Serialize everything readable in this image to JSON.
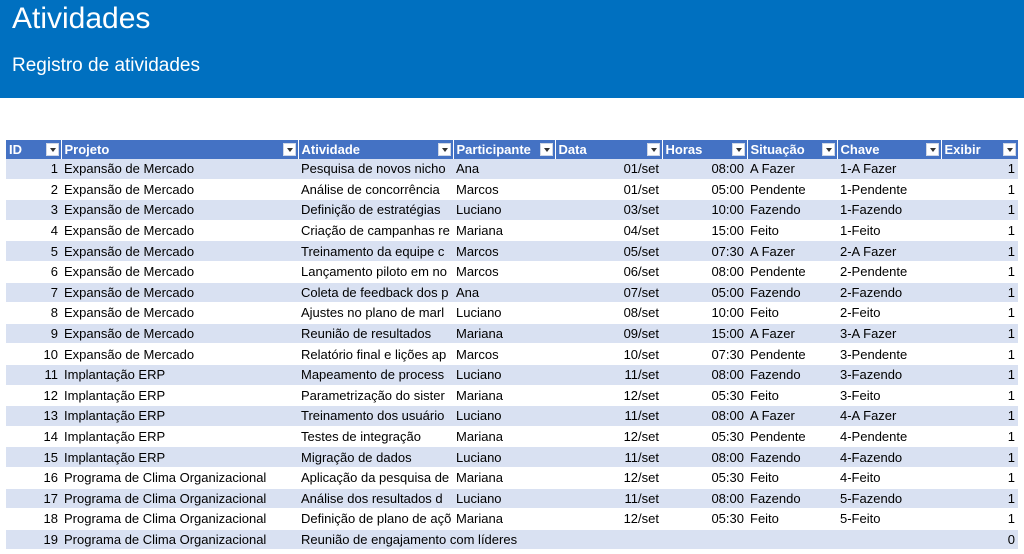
{
  "header": {
    "title": "Atividades",
    "subtitle": "Registro de atividades"
  },
  "colors": {
    "banner": "#0070c0",
    "table_header": "#4472c4",
    "band": "#d9e1f2"
  },
  "table": {
    "columns": [
      "ID",
      "Projeto",
      "Atividade",
      "Participante",
      "Data",
      "Horas",
      "Situação",
      "Chave",
      "Exibir"
    ],
    "rows": [
      {
        "id": "1",
        "projeto": "Expansão de Mercado",
        "atividade": "Pesquisa de novos nicho",
        "participante": "Ana",
        "data": "01/set",
        "horas": "08:00",
        "situacao": "A Fazer",
        "chave": "1-A Fazer",
        "exibir": "1"
      },
      {
        "id": "2",
        "projeto": "Expansão de Mercado",
        "atividade": "Análise de concorrência",
        "participante": "Marcos",
        "data": "01/set",
        "horas": "05:00",
        "situacao": "Pendente",
        "chave": "1-Pendente",
        "exibir": "1"
      },
      {
        "id": "3",
        "projeto": "Expansão de Mercado",
        "atividade": "Definição de estratégias",
        "participante": "Luciano",
        "data": "03/set",
        "horas": "10:00",
        "situacao": "Fazendo",
        "chave": "1-Fazendo",
        "exibir": "1"
      },
      {
        "id": "4",
        "projeto": "Expansão de Mercado",
        "atividade": "Criação de campanhas re",
        "participante": "Mariana",
        "data": "04/set",
        "horas": "15:00",
        "situacao": "Feito",
        "chave": "1-Feito",
        "exibir": "1"
      },
      {
        "id": "5",
        "projeto": "Expansão de Mercado",
        "atividade": "Treinamento da equipe c",
        "participante": "Marcos",
        "data": "05/set",
        "horas": "07:30",
        "situacao": "A Fazer",
        "chave": "2-A Fazer",
        "exibir": "1"
      },
      {
        "id": "6",
        "projeto": "Expansão de Mercado",
        "atividade": "Lançamento piloto em no",
        "participante": "Marcos",
        "data": "06/set",
        "horas": "08:00",
        "situacao": "Pendente",
        "chave": "2-Pendente",
        "exibir": "1"
      },
      {
        "id": "7",
        "projeto": "Expansão de Mercado",
        "atividade": "Coleta de feedback dos p",
        "participante": "Ana",
        "data": "07/set",
        "horas": "05:00",
        "situacao": "Fazendo",
        "chave": "2-Fazendo",
        "exibir": "1"
      },
      {
        "id": "8",
        "projeto": "Expansão de Mercado",
        "atividade": "Ajustes no plano de marl",
        "participante": "Luciano",
        "data": "08/set",
        "horas": "10:00",
        "situacao": "Feito",
        "chave": "2-Feito",
        "exibir": "1"
      },
      {
        "id": "9",
        "projeto": "Expansão de Mercado",
        "atividade": "Reunião de resultados",
        "participante": "Mariana",
        "data": "09/set",
        "horas": "15:00",
        "situacao": "A Fazer",
        "chave": "3-A Fazer",
        "exibir": "1"
      },
      {
        "id": "10",
        "projeto": "Expansão de Mercado",
        "atividade": "Relatório final e lições ap",
        "participante": "Marcos",
        "data": "10/set",
        "horas": "07:30",
        "situacao": "Pendente",
        "chave": "3-Pendente",
        "exibir": "1"
      },
      {
        "id": "11",
        "projeto": "Implantação ERP",
        "atividade": "Mapeamento de process",
        "participante": "Luciano",
        "data": "11/set",
        "horas": "08:00",
        "situacao": "Fazendo",
        "chave": "3-Fazendo",
        "exibir": "1"
      },
      {
        "id": "12",
        "projeto": "Implantação ERP",
        "atividade": "Parametrização do sister",
        "participante": "Mariana",
        "data": "12/set",
        "horas": "05:30",
        "situacao": "Feito",
        "chave": "3-Feito",
        "exibir": "1"
      },
      {
        "id": "13",
        "projeto": "Implantação ERP",
        "atividade": "Treinamento dos usuário",
        "participante": "Luciano",
        "data": "11/set",
        "horas": "08:00",
        "situacao": "A Fazer",
        "chave": "4-A Fazer",
        "exibir": "1"
      },
      {
        "id": "14",
        "projeto": "Implantação ERP",
        "atividade": "Testes de integração",
        "participante": "Mariana",
        "data": "12/set",
        "horas": "05:30",
        "situacao": "Pendente",
        "chave": "4-Pendente",
        "exibir": "1"
      },
      {
        "id": "15",
        "projeto": "Implantação ERP",
        "atividade": "Migração de dados",
        "participante": "Luciano",
        "data": "11/set",
        "horas": "08:00",
        "situacao": "Fazendo",
        "chave": "4-Fazendo",
        "exibir": "1"
      },
      {
        "id": "16",
        "projeto": "Programa de Clima Organizacional",
        "atividade": "Aplicação da pesquisa de",
        "participante": "Mariana",
        "data": "12/set",
        "horas": "05:30",
        "situacao": "Feito",
        "chave": "4-Feito",
        "exibir": "1"
      },
      {
        "id": "17",
        "projeto": "Programa de Clima Organizacional",
        "atividade": "Análise dos resultados d",
        "participante": "Luciano",
        "data": "11/set",
        "horas": "08:00",
        "situacao": "Fazendo",
        "chave": "5-Fazendo",
        "exibir": "1"
      },
      {
        "id": "18",
        "projeto": "Programa de Clima Organizacional",
        "atividade": "Definição de plano de açõ",
        "participante": "Mariana",
        "data": "12/set",
        "horas": "05:30",
        "situacao": "Feito",
        "chave": "5-Feito",
        "exibir": "1"
      },
      {
        "id": "19",
        "projeto": "Programa de Clima Organizacional",
        "atividade": "Reunião de engajamento com líderes",
        "participante": "",
        "data": "",
        "horas": "",
        "situacao": "",
        "chave": "",
        "exibir": "0"
      }
    ]
  }
}
